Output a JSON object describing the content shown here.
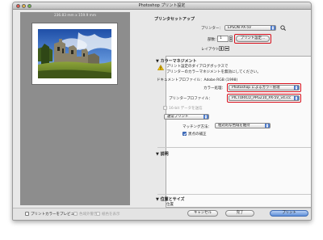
{
  "window": {
    "title": "Photoshop プリント設定"
  },
  "preview": {
    "dimensions_label": "236.83 mm x 159.9 mm"
  },
  "printer_setup": {
    "section_title": "プリンタセットアップ",
    "printer_label": "プリンター：",
    "printer_value": "EPSON PX-5V",
    "copies_label": "部数：",
    "copies_value": "1",
    "print_settings_button": "プリント設定...",
    "layout_label": "レイアウト："
  },
  "color_management": {
    "section_title": "カラーマネジメント",
    "warning_line1": "プリント設定のダイアログボックスで",
    "warning_line2": "プリンターのカラーマネジメントを無効にしてください。",
    "doc_profile_label": "ドキュメントプロファイル：Adobe RGB (1998)",
    "color_handling_label": "カラー処理：",
    "color_handling_value": "Photoshop によるカラー管理",
    "printer_profile_label": "プリンタープロファイル：",
    "printer_profile_value": "PICTORICO_PPG210_PX-5V_v4.icc",
    "bit16_label": "16-bit データを送信",
    "print_mode_value": "通常プリント",
    "rendering_intent_label": "マッチング方法：",
    "rendering_intent_value": "相対的な色域を維持",
    "bpc_label": "黒点の補正"
  },
  "description": {
    "section_title": "説明"
  },
  "position_size": {
    "section_title": "位置とサイズ",
    "sub_label": "位置"
  },
  "footer": {
    "preview_color_label": "プリントカラーをプレビュー",
    "gamut_warning_label": "色域外警告",
    "show_paper_white_label": "紙色を表示",
    "cancel_button": "キャンセル",
    "done_button": "完了",
    "print_button": "プリント"
  },
  "colors": {
    "highlight_red": "#d8101c",
    "popup_arrow_blue": "#4a78c8",
    "warning_yellow": "#f2c200"
  }
}
